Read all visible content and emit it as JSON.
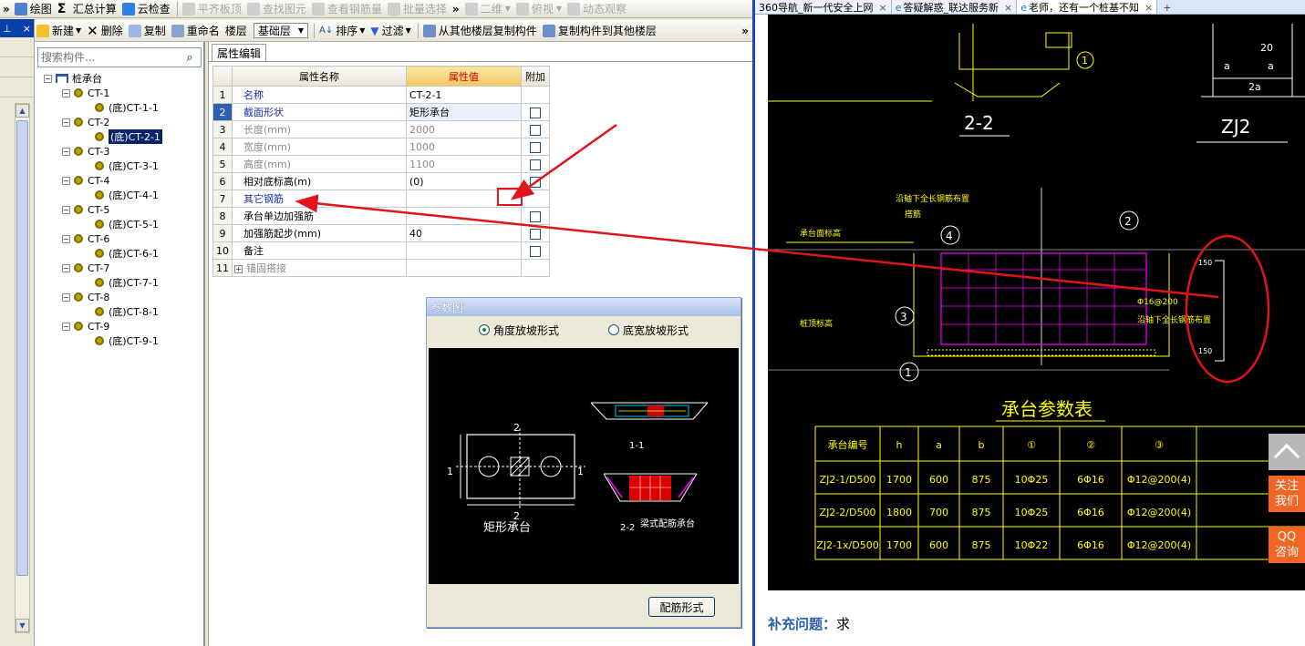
{
  "toolbar1": {
    "items": [
      {
        "label": "绘图",
        "enabled": true
      },
      {
        "label": "汇总计算",
        "enabled": true
      },
      {
        "label": "云检查",
        "enabled": true
      },
      {
        "label": "平齐板顶",
        "enabled": false
      },
      {
        "label": "查找图元",
        "enabled": false
      },
      {
        "label": "查看钢筋量",
        "enabled": false
      },
      {
        "label": "批量选择",
        "enabled": false
      },
      {
        "label": "二维",
        "enabled": false
      },
      {
        "label": "俯视",
        "enabled": false
      },
      {
        "label": "动态观察",
        "enabled": false
      }
    ]
  },
  "toolbar2": {
    "new": "新建",
    "delete": "删除",
    "copy": "复制",
    "rename": "重命名",
    "floor_label": "楼层",
    "floor_value": "基础层",
    "sort": "排序",
    "filter": "过滤",
    "copy_from": "从其他楼层复制构件",
    "copy_to": "复制构件到其他楼层"
  },
  "tree": {
    "search_placeholder": "搜索构件...",
    "root": "桩承台",
    "groups": [
      {
        "name": "CT-1",
        "child": "(底)CT-1-1"
      },
      {
        "name": "CT-2",
        "child": "(底)CT-2-1"
      },
      {
        "name": "CT-3",
        "child": "(底)CT-3-1"
      },
      {
        "name": "CT-4",
        "child": "(底)CT-4-1"
      },
      {
        "name": "CT-5",
        "child": "(底)CT-5-1"
      },
      {
        "name": "CT-6",
        "child": "(底)CT-6-1"
      },
      {
        "name": "CT-7",
        "child": "(底)CT-7-1"
      },
      {
        "name": "CT-8",
        "child": "(底)CT-8-1"
      },
      {
        "name": "CT-9",
        "child": "(底)CT-9-1"
      }
    ],
    "selected": "(底)CT-2-1"
  },
  "props": {
    "tab": "属性编辑",
    "col_name": "属性名称",
    "col_value": "属性值",
    "col_add": "附加",
    "rows": [
      {
        "n": "1",
        "name": "名称",
        "value": "CT-2-1",
        "cb": false,
        "style": "blue"
      },
      {
        "n": "2",
        "name": "截面形状",
        "value": "矩形承台",
        "cb": true,
        "style": "cur"
      },
      {
        "n": "3",
        "name": "长度(mm)",
        "value": "2000",
        "cb": true,
        "style": "gray"
      },
      {
        "n": "4",
        "name": "宽度(mm)",
        "value": "1000",
        "cb": true,
        "style": "gray"
      },
      {
        "n": "5",
        "name": "高度(mm)",
        "value": "1100",
        "cb": true,
        "style": "gray"
      },
      {
        "n": "6",
        "name": "相对底标高(m)",
        "value": "(0)",
        "cb": true,
        "style": ""
      },
      {
        "n": "7",
        "name": "其它钢筋",
        "value": "",
        "cb": false,
        "style": "blue"
      },
      {
        "n": "8",
        "name": "承台单边加强筋",
        "value": "",
        "cb": true,
        "style": ""
      },
      {
        "n": "9",
        "name": "加强筋起步(mm)",
        "value": "40",
        "cb": true,
        "style": ""
      },
      {
        "n": "10",
        "name": "备注",
        "value": "",
        "cb": true,
        "style": ""
      },
      {
        "n": "11",
        "name": "锚固搭接",
        "value": "",
        "cb": false,
        "style": "gray",
        "expand": "+"
      }
    ]
  },
  "dialog": {
    "title": "参数图",
    "radio1": "角度放坡形式",
    "radio2": "底宽放坡形式",
    "img_label1": "矩形承台",
    "img_label2": "梁式配筋承台",
    "img_mark_2": "2",
    "img_mark_1": "1",
    "img_sec_11": "1-1",
    "img_sec_22": "2-2",
    "button": "配筋形式"
  },
  "browser": {
    "tabs": [
      {
        "label": "360导航_新一代安全上网"
      },
      {
        "label": "答疑解惑_联达服务新"
      },
      {
        "label": "老师，还有一个桩基不知"
      }
    ],
    "newtab": "+",
    "cad": {
      "sec22": "2-2",
      "zj2": "ZJ2",
      "dim_a1": "a",
      "dim_a2": "a",
      "dim_2a": "2a",
      "dim_20": "20",
      "table_title": "承台参数表",
      "header": [
        "承台编号",
        "h",
        "a",
        "b",
        "①",
        "②",
        "③"
      ],
      "rows": [
        [
          "ZJ2-1/D500",
          "1700",
          "600",
          "875",
          "10Φ25",
          "6Φ16",
          "Φ12@200(4)"
        ],
        [
          "ZJ2-2/D500",
          "1800",
          "700",
          "875",
          "10Φ25",
          "6Φ16",
          "Φ12@200(4)"
        ],
        [
          "ZJ2-1x/D500",
          "1700",
          "600",
          "875",
          "10Φ22",
          "6Φ16",
          "Φ12@200(4)"
        ]
      ],
      "label_left1": "承台面标高",
      "label_left2": "桩顶标高",
      "label_top": "沿轴下全长钢筋布置",
      "label_top2": "搭筋",
      "label_right": "Φ16@200",
      "label_right2": "沿轴下全长钢筋布置",
      "circ1": "1",
      "circ2": "2",
      "circ3": "3",
      "circ4": "4",
      "num150a": "150",
      "num150b": "150"
    },
    "supplement_label": "补充问题：",
    "supplement_text": "求",
    "float_follow": "关注我们",
    "float_qq": "QQ咨询"
  },
  "colors": {
    "annotation_red": "#e0141a",
    "accent_orange": "#f26522",
    "header_gold": "#f2c65e"
  }
}
